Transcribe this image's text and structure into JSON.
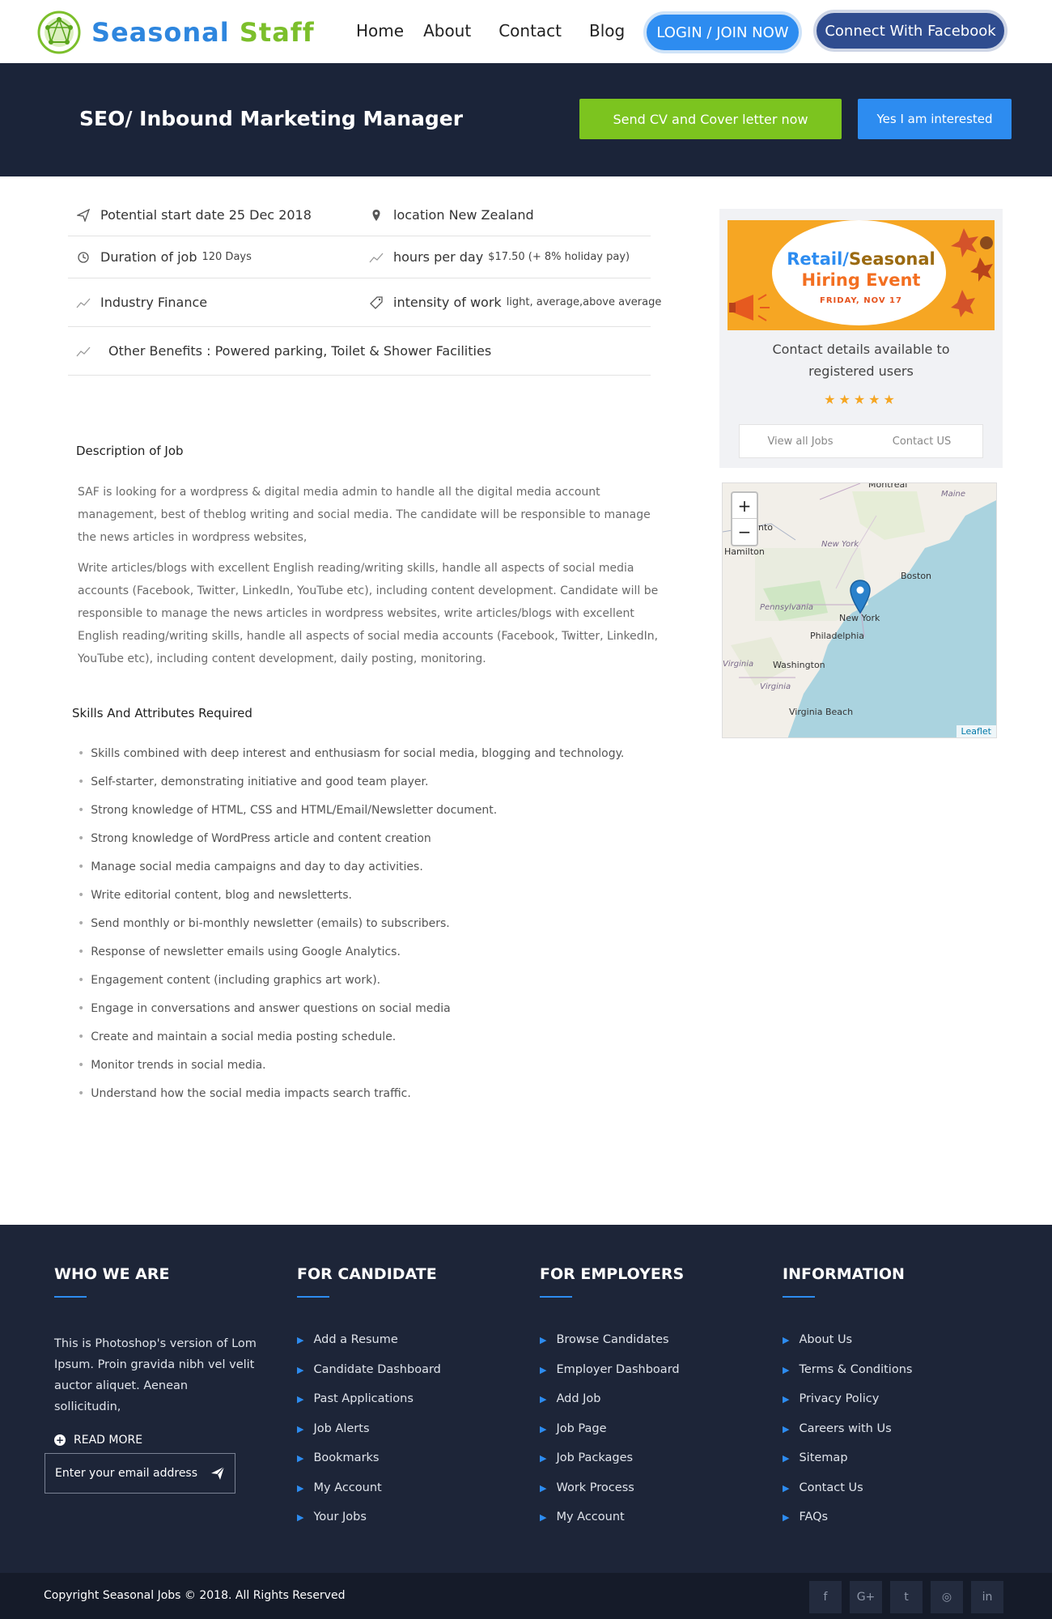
{
  "header": {
    "logo_part1": "Seasonal",
    "logo_part2": "Staff",
    "nav": [
      "Home",
      "About",
      "Contact",
      "Blog"
    ],
    "login_label": "LOGIN / JOIN NOW",
    "facebook_label": "Connect With Facebook"
  },
  "hero": {
    "title": "SEO/ Inbound Marketing Manager",
    "send_cv_label": "Send CV and Cover letter now",
    "interested_label": "Yes I am interested"
  },
  "info": {
    "start_date": "Potential start date 25 Dec 2018",
    "location": "location New Zealand",
    "duration_label": "Duration of job",
    "duration_value": "120 Days",
    "hours_label": "hours per day",
    "hours_value": "$17.50 (+ 8% holiday pay)",
    "industry": "Industry Finance",
    "intensity_label": "intensity of work",
    "intensity_value": "light, average,above average",
    "benefits": "Other Benefits : Powered parking, Toilet & Shower Facilities"
  },
  "description": {
    "heading": "Description of Job",
    "para1": "SAF is looking for a wordpress & digital media admin to handle all the digital media account management, best of theblog writing and social media. The candidate will be responsible to manage the news articles in wordpress websites,",
    "para2": "Write articles/blogs with excellent English reading/writing skills, handle all aspects of social media accounts (Facebook, Twitter, LinkedIn, YouTube etc), including content development. Candidate will be responsible to manage the news articles in wordpress websites, write articles/blogs with excellent English reading/writing skills, handle all aspects of social media accounts (Facebook, Twitter, LinkedIn, YouTube etc), including content development, daily posting, monitoring."
  },
  "skills": {
    "heading": "Skills And Attributes Required",
    "items": [
      "Skills combined with deep interest and enthusiasm for social media, blogging and technology.",
      "Self-starter, demonstrating initiative and good team player.",
      "Strong knowledge of HTML, CSS and HTML/Email/Newsletter document.",
      "Strong knowledge of WordPress article and content creation",
      "Manage social media campaigns and day to day activities.",
      "Write editorial content, blog and newsletterts.",
      "Send monthly or bi-monthly newsletter (emails) to subscribers.",
      "Response of newsletter emails using Google Analytics.",
      "Engagement content (including graphics art work).",
      "Engage in conversations and answer questions on social media",
      "Create and maintain a social media posting schedule.",
      "Monitor trends in social media.",
      "Understand how the social media impacts search traffic."
    ]
  },
  "sidebar": {
    "promo_line1_a": "Retail/",
    "promo_line1_b": "Seasonal",
    "promo_line2": "Hiring Event",
    "promo_date": "FRIDAY, NOV 17",
    "contact_text": "Contact details available to registered users",
    "stars": "★★★★★",
    "view_jobs": "View all Jobs",
    "contact_us": "Contact US"
  },
  "map": {
    "zoom_in": "+",
    "zoom_out": "−",
    "labels": {
      "montreal": "Montreal",
      "maine": "Maine",
      "toronto": "nto",
      "hamilton": "Hamilton",
      "newyork_state": "New York",
      "boston": "Boston",
      "pennsylvania": "Pennsylvania",
      "newyork_city": "New York",
      "philadelphia": "Philadelphia",
      "virginia_w": "Virginia",
      "washington": "Washington",
      "virginia": "Virginia",
      "virginia_beach": "Virginia Beach"
    },
    "attribution": "Leaflet"
  },
  "footer": {
    "who": {
      "heading": "WHO WE ARE",
      "text": "This is Photoshop's version of Lom Ipsum. Proin gravida nibh vel velit auctor aliquet. Aenean sollicitudin,",
      "read_more": "READ MORE",
      "email_placeholder": "Enter your email address"
    },
    "candidate": {
      "heading": "FOR CANDIDATE",
      "items": [
        "Add a Resume",
        "Candidate Dashboard",
        "Past Applications",
        "Job Alerts",
        "Bookmarks",
        "My Account",
        "Your Jobs"
      ]
    },
    "employers": {
      "heading": "FOR EMPLOYERS",
      "items": [
        "Browse Candidates",
        "Employer Dashboard",
        "Add Job",
        "Job Page",
        "Job Packages",
        "Work Process",
        "My Account"
      ]
    },
    "information": {
      "heading": "INFORMATION",
      "items": [
        "About Us",
        "Terms & Conditions",
        "Privacy Policy",
        "Careers with Us",
        "Sitemap",
        "Contact Us",
        "FAQs"
      ]
    },
    "copyright": "Copyright Seasonal Jobs © 2018. All Rights Reserved",
    "socials": [
      "f",
      "G+",
      "t",
      "◎",
      "in"
    ]
  },
  "colors": {
    "brand_blue": "#2d8cf0",
    "brand_green": "#7cc41f",
    "hero_bg": "#1b2439",
    "footer_bg": "#1d2538"
  }
}
